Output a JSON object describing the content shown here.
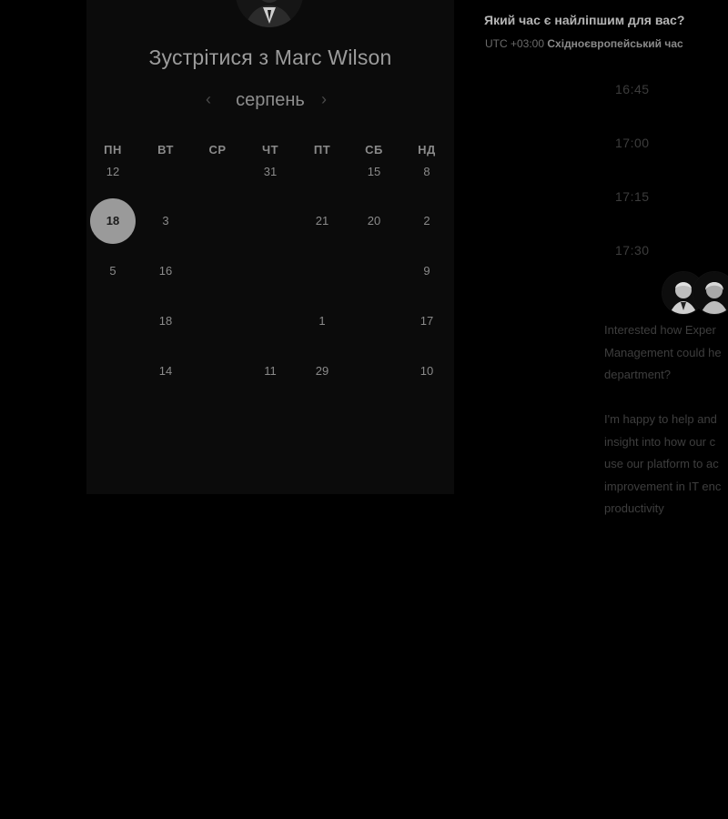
{
  "calendar": {
    "title": "Зустрітися з Marc Wilson",
    "month": "серпень",
    "prev_icon": "chevron-left-icon",
    "next_icon": "chevron-right-icon",
    "weekdays": [
      "ПН",
      "ВТ",
      "СР",
      "ЧТ",
      "ПТ",
      "СБ",
      "НД"
    ],
    "weeks": [
      [
        "12",
        "",
        "",
        "31",
        "",
        "15",
        "8"
      ],
      [
        "18",
        "3",
        "",
        "",
        "21",
        "20",
        "2"
      ],
      [
        "5",
        "16",
        "",
        "",
        "",
        "",
        "9"
      ],
      [
        "",
        "18",
        "",
        "",
        "1",
        "",
        "17"
      ],
      [
        "",
        "14",
        "",
        "11",
        "29",
        "",
        "10"
      ]
    ],
    "selected_day": "18"
  },
  "panel": {
    "title": "Який час є найліпшим для вас?",
    "timezone_offset": "UTC +03:00",
    "timezone_name": "Східноєвропейський час",
    "slots": [
      "16:45",
      "17:00",
      "17:15",
      "17:30"
    ],
    "bio": "Interested how Exper\nManagement could he\ndepartment?\n\nI'm happy to help and\ninsight into how our c\nuse our platform to ac\nimprovement in IT enc\nproductivity"
  },
  "colors": {
    "background": "#000000",
    "card": "#0b0b0b",
    "selected_day": "#9a9a9a"
  }
}
